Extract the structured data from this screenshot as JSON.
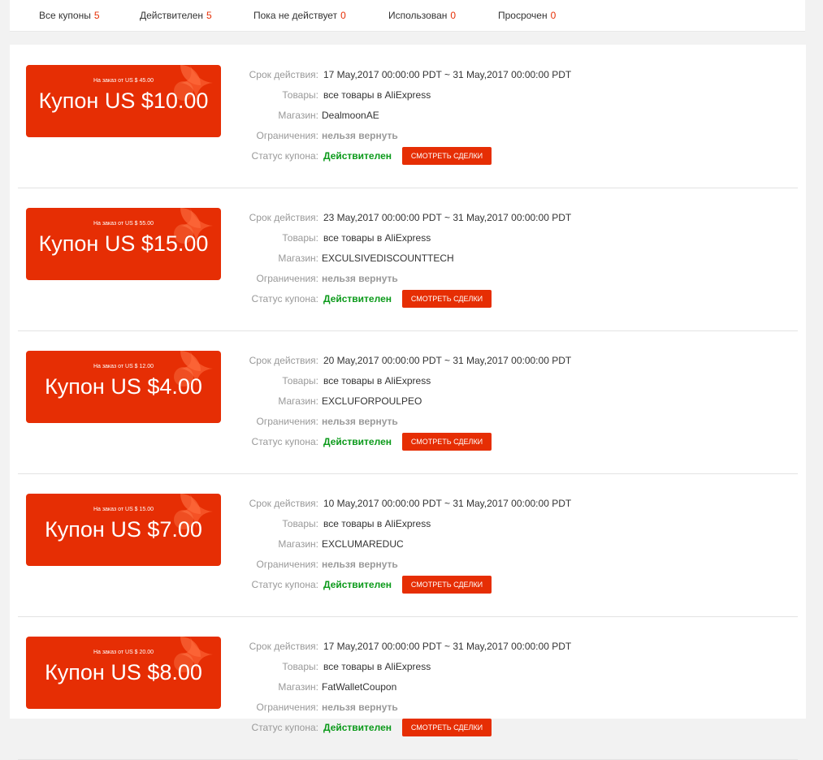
{
  "tabs": [
    {
      "label": "Все купоны",
      "count": "5"
    },
    {
      "label": "Действителен",
      "count": "5"
    },
    {
      "label": "Пока не действует",
      "count": "0"
    },
    {
      "label": "Использован",
      "count": "0"
    },
    {
      "label": "Просрочен",
      "count": "0"
    }
  ],
  "labels": {
    "validity": "Срок действия:",
    "goods": "Товары:",
    "store": "Магазин:",
    "restrictions": "Ограничения:",
    "status": "Статус купона:"
  },
  "coupons": [
    {
      "min_order": "На заказ от US $ 45.00",
      "amount": "Купон US $10.00",
      "validity": "17 May,2017 00:00:00 PDT ~ 31 May,2017 00:00:00 PDT",
      "goods": "все товары в AliExpress",
      "store": "DealmoonAE",
      "restrictions": "нельзя вернуть",
      "status": "Действителен",
      "button": "Смотреть сделки"
    },
    {
      "min_order": "На заказ от US $ 55.00",
      "amount": "Купон US $15.00",
      "validity": "23 May,2017 00:00:00 PDT ~ 31 May,2017 00:00:00 PDT",
      "goods": "все товары в AliExpress",
      "store": "EXCULSIVEDISCOUNTTECH",
      "restrictions": "нельзя вернуть",
      "status": "Действителен",
      "button": "Смотреть сделки"
    },
    {
      "min_order": "На заказ от US $ 12.00",
      "amount": "Купон US $4.00",
      "validity": "20 May,2017 00:00:00 PDT ~ 31 May,2017 00:00:00 PDT",
      "goods": "все товары в AliExpress",
      "store": "EXCLUFORPOULPEO",
      "restrictions": "нельзя вернуть",
      "status": "Действителен",
      "button": "Смотреть сделки"
    },
    {
      "min_order": "На заказ от US $ 15.00",
      "amount": "Купон US $7.00",
      "validity": "10 May,2017 00:00:00 PDT ~ 31 May,2017 00:00:00 PDT",
      "goods": "все товары в AliExpress",
      "store": "EXCLUMAREDUC",
      "restrictions": "нельзя вернуть",
      "status": "Действителен",
      "button": "Смотреть сделки"
    },
    {
      "min_order": "На заказ от US $ 20.00",
      "amount": "Купон US $8.00",
      "validity": "17 May,2017 00:00:00 PDT ~ 31 May,2017 00:00:00 PDT",
      "goods": "все товары в AliExpress",
      "store": "FatWalletCoupon",
      "restrictions": "нельзя вернуть",
      "status": "Действителен",
      "button": "Смотреть сделки"
    }
  ],
  "colors": {
    "accent": "#e62e04",
    "valid": "#0b9a1a"
  }
}
